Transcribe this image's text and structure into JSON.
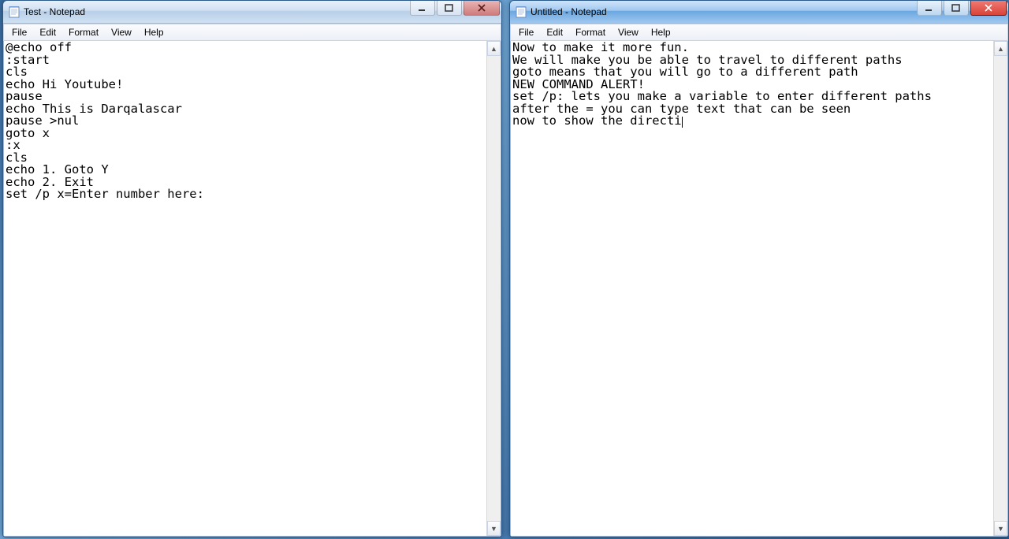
{
  "windows": {
    "left": {
      "title": "Test - Notepad",
      "active": false,
      "menu": [
        "File",
        "Edit",
        "Format",
        "View",
        "Help"
      ],
      "content": "@echo off\n:start\ncls\necho Hi Youtube!\npause\necho This is Darqalascar\npause >nul\ngoto x\n:x\ncls\necho 1. Goto Y\necho 2. Exit\nset /p x=Enter number here:"
    },
    "right": {
      "title": "Untitled - Notepad",
      "active": true,
      "menu": [
        "File",
        "Edit",
        "Format",
        "View",
        "Help"
      ],
      "content_before_cursor": "Now to make it more fun.\nWe will make you be able to travel to different paths\ngoto means that you will go to a different path\nNEW COMMAND ALERT!\nset /p: lets you make a variable to enter different paths\nafter the = you can type text that can be seen\nnow to show the directi",
      "content_after_cursor": ""
    }
  },
  "buttons": {
    "minimize_tip": "Minimize",
    "maximize_tip": "Maximize",
    "close_tip": "Close"
  }
}
